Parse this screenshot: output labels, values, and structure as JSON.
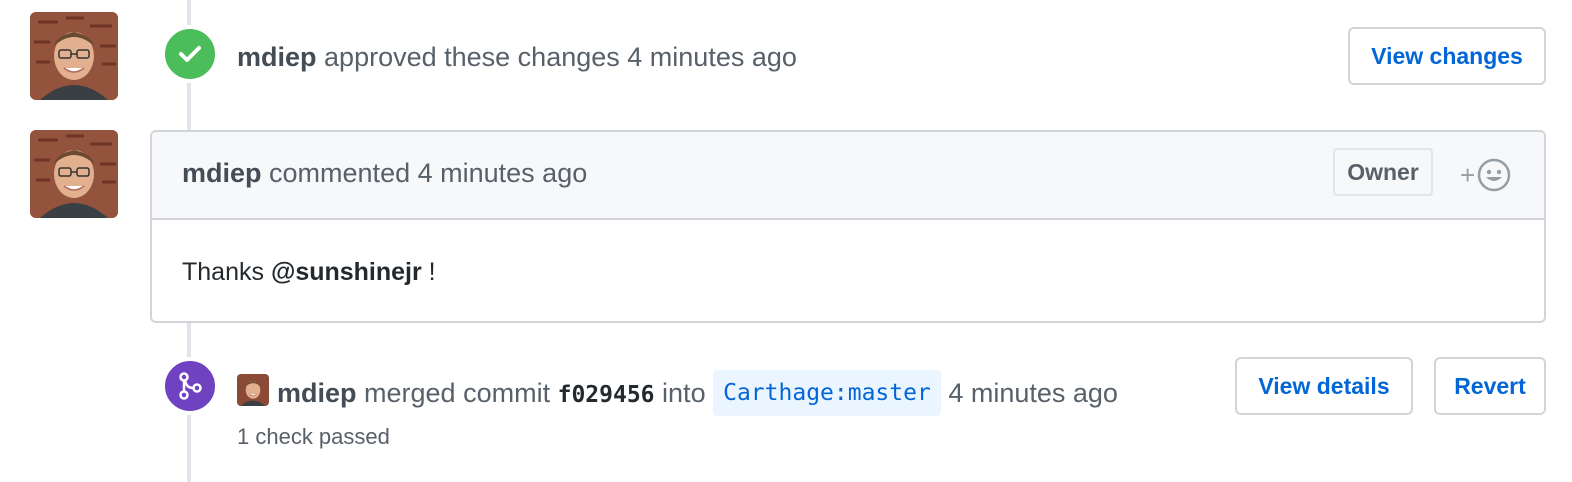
{
  "approval": {
    "author": "mdiep",
    "action": "approved these changes",
    "time": "4 minutes ago",
    "view_changes_label": "View changes"
  },
  "comment": {
    "author": "mdiep",
    "action": "commented",
    "time": "4 minutes ago",
    "owner_label": "Owner",
    "reaction_plus": "+",
    "body_prefix": "Thanks ",
    "mention": "@sunshinejr",
    "body_suffix": " !"
  },
  "merge": {
    "author": "mdiep",
    "action": "merged commit",
    "sha": "f029456",
    "into": "into",
    "branch": "Carthage:master",
    "time": "4 minutes ago",
    "checks": "1 check passed",
    "view_details_label": "View details",
    "revert_label": "Revert"
  },
  "colors": {
    "approved_green": "#4cbd5b",
    "merged_purple": "#6f42c1",
    "link_blue": "#0366d6"
  },
  "icons": {
    "approval": "check-icon",
    "merge": "git-merge-icon",
    "reaction": "smiley-icon"
  }
}
